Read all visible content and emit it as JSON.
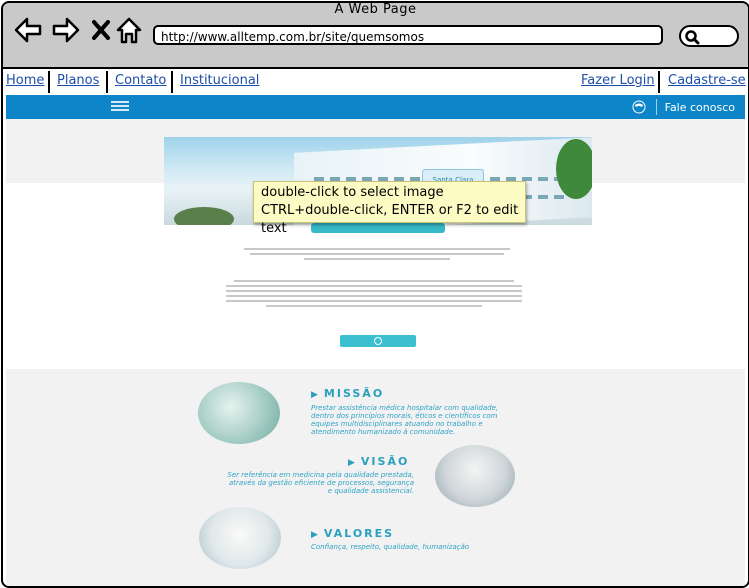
{
  "window": {
    "title": "A Web Page"
  },
  "browser": {
    "url": "http://www.alltemp.com.br/site/quemsomos",
    "icons": [
      "back-arrow-icon",
      "forward-arrow-icon",
      "close-x-icon",
      "home-icon",
      "search-icon"
    ]
  },
  "topnav": {
    "left": [
      "Home",
      "Planos",
      "Contato",
      "Institucional"
    ],
    "right": [
      "Fazer Login",
      "Cadastre-se"
    ]
  },
  "header": {
    "contact_label": "Fale conosco"
  },
  "tooltip": {
    "line1": "double-click to select image",
    "line2": "CTRL+double-click, ENTER or F2 to edit text"
  },
  "hero": {
    "sign_text": "Santa Clara"
  },
  "sections": {
    "missao": {
      "title": "MISSÃO",
      "text": "Prestar assistência médica hospitalar com qualidade, dentro dos princípios morais, éticos e científicos com equipes multidisciplinares atuando no trabalho e atendimento humanizado à comunidade."
    },
    "visao": {
      "title": "VISÃO",
      "text": "Ser referência em medicina pela qualidade prestada, através da gestão eficiente de processos, segurança e qualidade assistencial."
    },
    "valores": {
      "title": "VALORES",
      "text": "Confiança, respeito, qualidade, humanização"
    }
  },
  "colors": {
    "brand_blue": "#0e85c8",
    "accent_teal": "#37b9c9",
    "link": "#1d4ea8"
  }
}
